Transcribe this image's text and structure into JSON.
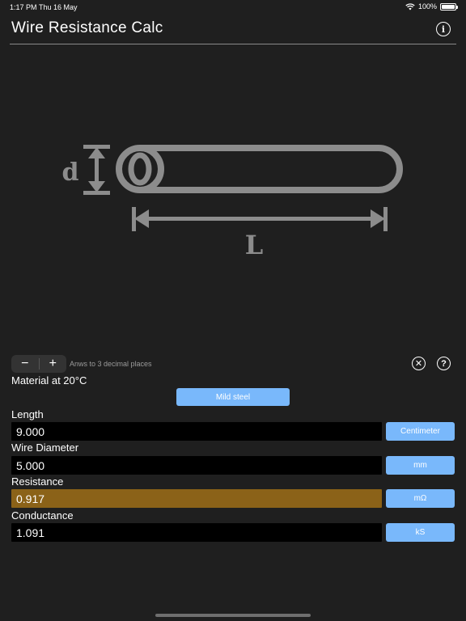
{
  "status": {
    "time": "1:17 PM",
    "date": "Thu 16 May",
    "battery": "100%"
  },
  "header": {
    "title": "Wire Resistance Calc"
  },
  "diagram": {
    "diameter_label": "d",
    "length_label": "L"
  },
  "controls": {
    "decrement": "−",
    "increment": "+",
    "precision_text": "Anws to 3 decimal places",
    "clear_glyph": "✕",
    "help_glyph": "?"
  },
  "material": {
    "label": "Material at 20°C",
    "value": "Mild steel"
  },
  "fields": {
    "length": {
      "label": "Length",
      "value": "9.000",
      "unit": "Centimeter"
    },
    "diameter": {
      "label": "Wire Diameter",
      "value": "5.000",
      "unit": "mm"
    },
    "resistance": {
      "label": "Resistance",
      "value": "0.917",
      "unit": "mΩ"
    },
    "conductance": {
      "label": "Conductance",
      "value": "1.091",
      "unit": "kS"
    }
  },
  "colors": {
    "background": "#1f1f1f",
    "accent_button": "#79b8fb",
    "result_highlight": "#8b6218",
    "diagram_gray": "#8c8c8c"
  }
}
